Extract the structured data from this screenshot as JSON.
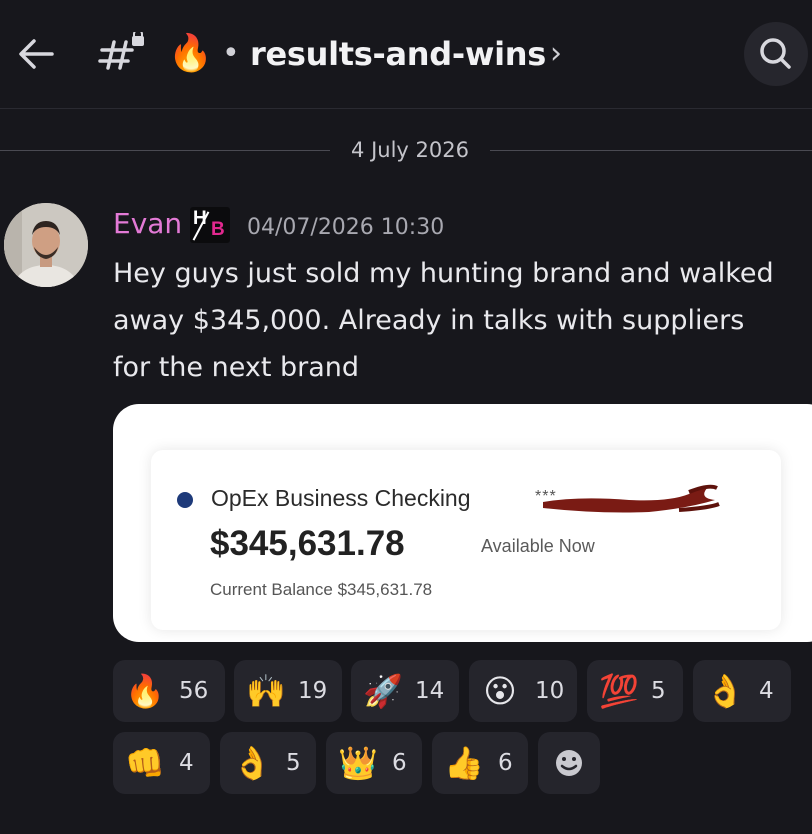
{
  "header": {
    "channel_emoji": "🔥",
    "separator": "•",
    "channel_name": "results-and-wins",
    "chevron": "›",
    "icons": {
      "back": "back-arrow-icon",
      "channel": "locked-hash-icon",
      "search": "search-icon"
    }
  },
  "date_divider": "4 July 2026",
  "message": {
    "username": "Evan",
    "role_badge": {
      "top": "H",
      "bottom": "B"
    },
    "timestamp": "04/07/2026 10:30",
    "body": "Hey guys just sold my hunting brand  and walked\naway $345,000. Already in talks with suppliers\nfor the next brand",
    "colors": {
      "username": "#e37ad6",
      "background": "#17171c"
    }
  },
  "embed": {
    "account_name": "OpEx Business Checking",
    "account_mask": "***",
    "balance": "$345,631.78",
    "available_label": "Available Now",
    "current_balance": "Current Balance $345,631.78"
  },
  "reactions": [
    {
      "emoji": "🔥",
      "count": "56"
    },
    {
      "emoji": "🙌",
      "count": "19"
    },
    {
      "emoji": "🚀",
      "count": "14"
    },
    {
      "emoji": "😮",
      "count": "10"
    },
    {
      "emoji": "💯",
      "count": "5"
    },
    {
      "emoji": "👌",
      "count": "4"
    },
    {
      "emoji": "👊",
      "count": "4"
    },
    {
      "emoji": "👌",
      "count": "5"
    },
    {
      "emoji": "👑",
      "count": "6"
    },
    {
      "emoji": "👍",
      "count": "6"
    }
  ],
  "add_reaction_icon": "add-reaction-icon"
}
